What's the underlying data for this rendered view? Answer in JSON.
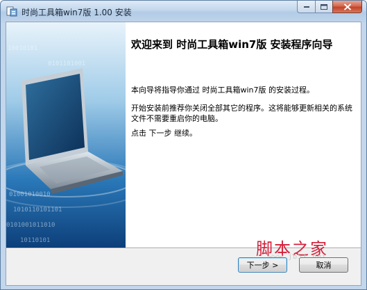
{
  "window": {
    "title": "时尚工具箱win7版 1.00 安装"
  },
  "icons": {
    "app": "installer-icon",
    "minimize": "minimize-icon",
    "maximize": "maximize-icon",
    "close": "close-icon"
  },
  "content": {
    "heading": "欢迎来到 时尚工具箱win7版 安装程序向导",
    "paragraph1": "本向导将指导你通过 时尚工具箱win7版 的安装过程。",
    "paragraph2": "开始安装前推荐你关闭全部其它的程序。这将能够更新相关的系统文件不需要重启你的电脑。",
    "paragraph3": "点击 下一步 继续。"
  },
  "buttons": {
    "next_label": "下一步 >",
    "cancel_label": "取消"
  },
  "watermark": {
    "text": "脚本之家",
    "url": "www.jb51.net"
  },
  "colors": {
    "title_bar": "#c2d7ed",
    "close_button": "#c4422a",
    "watermark": "#d4203a"
  }
}
